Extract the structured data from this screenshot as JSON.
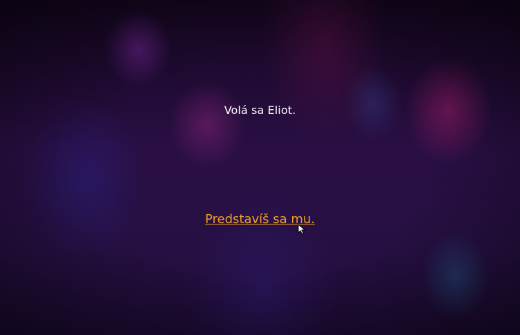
{
  "dialogue": {
    "line": "Volá sa Eliot."
  },
  "choices": [
    {
      "label": "Predstavíš sa mu."
    }
  ],
  "colors": {
    "text": "#ffffff",
    "link": "#f0a024",
    "background": "#261043"
  },
  "icons": {
    "cursor": "mouse-pointer-icon"
  }
}
